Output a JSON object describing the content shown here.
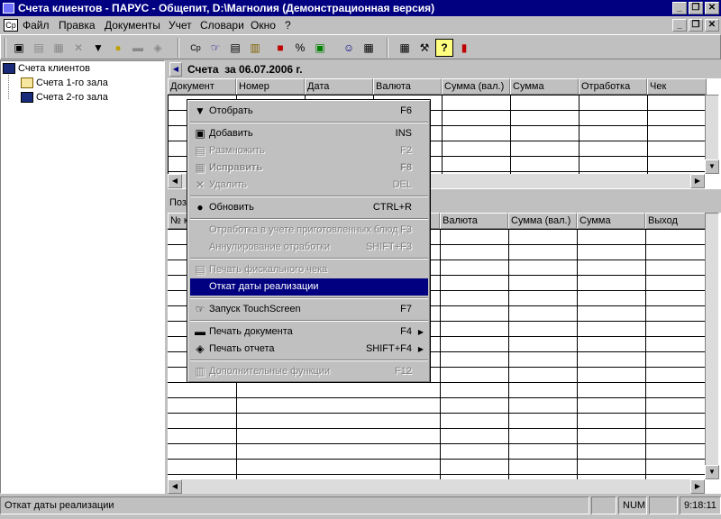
{
  "window": {
    "title": "Счета клиентов - ПАРУС - Общепит, D:\\Магнолия (Демонстрационная версия)",
    "minimize_label": "_",
    "restore_label": "❐",
    "close_label": "✕"
  },
  "menubar": {
    "items": [
      "Файл",
      "Правка",
      "Документы",
      "Учет",
      "Словари",
      "Окно",
      "?"
    ]
  },
  "tree": {
    "root": "Счета клиентов",
    "children": [
      "Счета 1-го зала",
      "Счета 2-го зала"
    ]
  },
  "top_panel": {
    "title": "Счета  за 06.07.2006 г.",
    "columns": [
      "Документ",
      "Номер",
      "Дата",
      "Валюта",
      "Сумма (вал.)",
      "Сумма",
      "Отработка",
      "Чек"
    ]
  },
  "bottom_panel": {
    "tab": "Поз",
    "columns": [
      "№ к",
      "",
      "",
      "Валюта",
      "Сумма (вал.)",
      "Сумма",
      "Выход"
    ]
  },
  "context_menu": {
    "items": [
      {
        "label": "Отобрать",
        "shortcut": "F6",
        "icon": "filter-icon",
        "glyph": "▼",
        "state": "normal"
      },
      {
        "separator": true
      },
      {
        "label": "Добавить",
        "shortcut": "INS",
        "icon": "add-doc-icon",
        "glyph": "▣",
        "state": "normal"
      },
      {
        "label": "Размножить",
        "shortcut": "F2",
        "icon": "copy-icon",
        "glyph": "▤",
        "state": "disabled"
      },
      {
        "label": "Исправить",
        "shortcut": "F8",
        "icon": "edit-icon",
        "glyph": "▦",
        "state": "disabled-bold"
      },
      {
        "label": "Удалить",
        "shortcut": "DEL",
        "icon": "delete-icon",
        "glyph": "✕",
        "state": "disabled"
      },
      {
        "separator": true
      },
      {
        "label": "Обновить",
        "shortcut": "CTRL+R",
        "icon": "refresh-icon",
        "glyph": "●",
        "state": "normal"
      },
      {
        "separator": true
      },
      {
        "label": "Отработка в учете приготовленных блюд",
        "shortcut": "F3",
        "icon": "",
        "glyph": "",
        "state": "disabled"
      },
      {
        "label": "Аннулирование отработки",
        "shortcut": "SHIFT+F3",
        "icon": "",
        "glyph": "",
        "state": "disabled"
      },
      {
        "separator": true
      },
      {
        "label": "Печать фискального чека",
        "shortcut": "",
        "icon": "receipt-icon",
        "glyph": "▤",
        "state": "disabled"
      },
      {
        "label": "Откат даты реализации",
        "shortcut": "",
        "icon": "",
        "glyph": "",
        "state": "selected"
      },
      {
        "separator": true
      },
      {
        "label": "Запуск TouchScreen",
        "shortcut": "F7",
        "icon": "touchscreen-icon",
        "glyph": "☞",
        "state": "normal"
      },
      {
        "separator": true
      },
      {
        "label": "Печать документа",
        "shortcut": "F4",
        "icon": "printer-icon",
        "glyph": "▬",
        "state": "normal",
        "submenu": true
      },
      {
        "label": "Печать отчета",
        "shortcut": "SHIFT+F4",
        "icon": "report-icon",
        "glyph": "◈",
        "state": "normal",
        "submenu": true
      },
      {
        "separator": true
      },
      {
        "label": "Дополнительные функции",
        "shortcut": "F12",
        "icon": "functions-icon",
        "glyph": "▥",
        "state": "disabled"
      }
    ]
  },
  "statusbar": {
    "message": "Откат даты реализации",
    "num": "NUM",
    "time": "9:18:11"
  }
}
